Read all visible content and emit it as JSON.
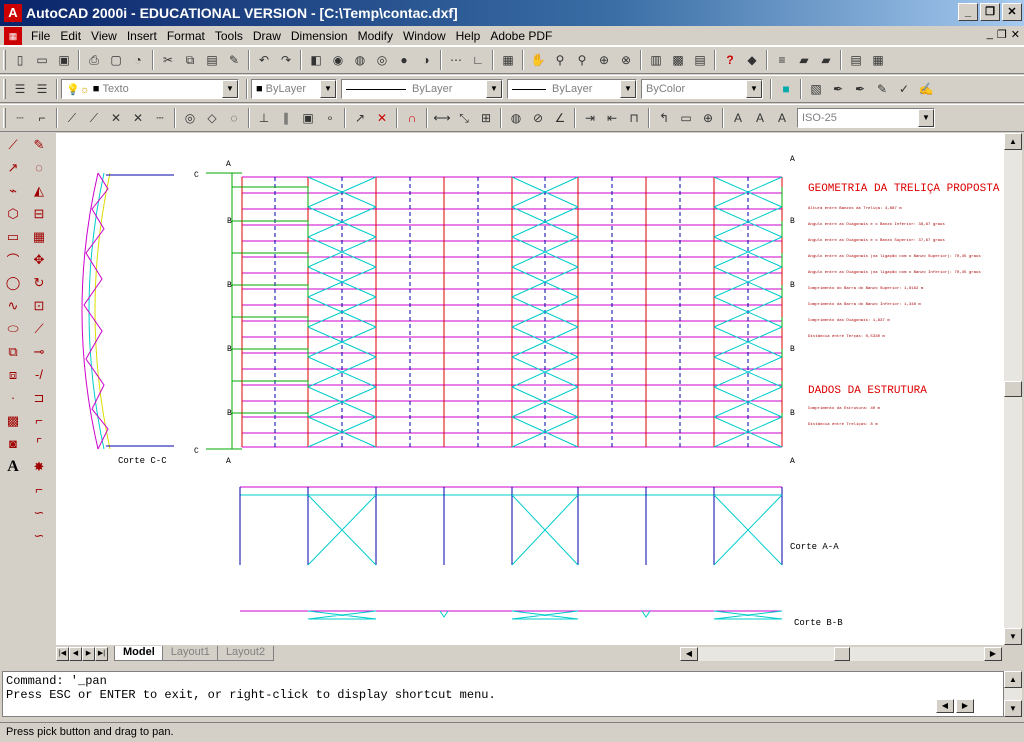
{
  "window": {
    "title": "AutoCAD 2000i - EDUCATIONAL VERSION - [C:\\Temp\\contac.dxf]"
  },
  "menu": {
    "items": [
      "File",
      "Edit",
      "View",
      "Insert",
      "Format",
      "Tools",
      "Draw",
      "Dimension",
      "Modify",
      "Window",
      "Help",
      "Adobe PDF"
    ]
  },
  "properties": {
    "text_style": "Texto",
    "layer": "ByLayer",
    "linetype": "ByLayer",
    "lineweight": "ByLayer",
    "color": "ByColor",
    "dimstyle": "ISO-25"
  },
  "tabs": [
    {
      "label": "Model",
      "active": true
    },
    {
      "label": "Layout1",
      "active": false
    },
    {
      "label": "Layout2",
      "active": false
    }
  ],
  "command": {
    "line1": "Command: '_pan",
    "line2": "Press ESC or ENTER to exit, or right-click to display shortcut menu."
  },
  "status": {
    "text": "Press pick button and drag to pan."
  },
  "drawing": {
    "title1": "GEOMETRIA DA TRELIÇA PROPOSTA",
    "title1_lines": [
      "Altura entre Banzos da Treliça: 4,887 m",
      "Angulo entre as Diagonais e o Banzo Inferior: 38,67 graus",
      "Angulo entre as Diagonais e o Banzo Superior: 37,67 graus",
      "Angulo entre as Diagonais (na ligação com o Banzo Superior): 70,45 graus",
      "Angulo entre as Diagonais (na ligação com o Banzo Inferior): 70,45 graus",
      "Comprimento do Barra do Banzo Superior: 1,8162 m",
      "Comprimento da Barra do Banzo Inferior: 1,348 m",
      "Comprimento das Diagonais: 1,837 m",
      "Distância entre Terças: 0,5330 m"
    ],
    "title2": "DADOS DA ESTRUTURA",
    "title2_lines": [
      "Comprimento da Estrutura: 40 m",
      "Distância entre Treliças: 8 m"
    ],
    "label_cc": "Corte C-C",
    "label_aa": "Corte A-A",
    "label_bb": "Corte B-B",
    "mark_a": "A",
    "mark_b": "B",
    "mark_c": "C"
  }
}
